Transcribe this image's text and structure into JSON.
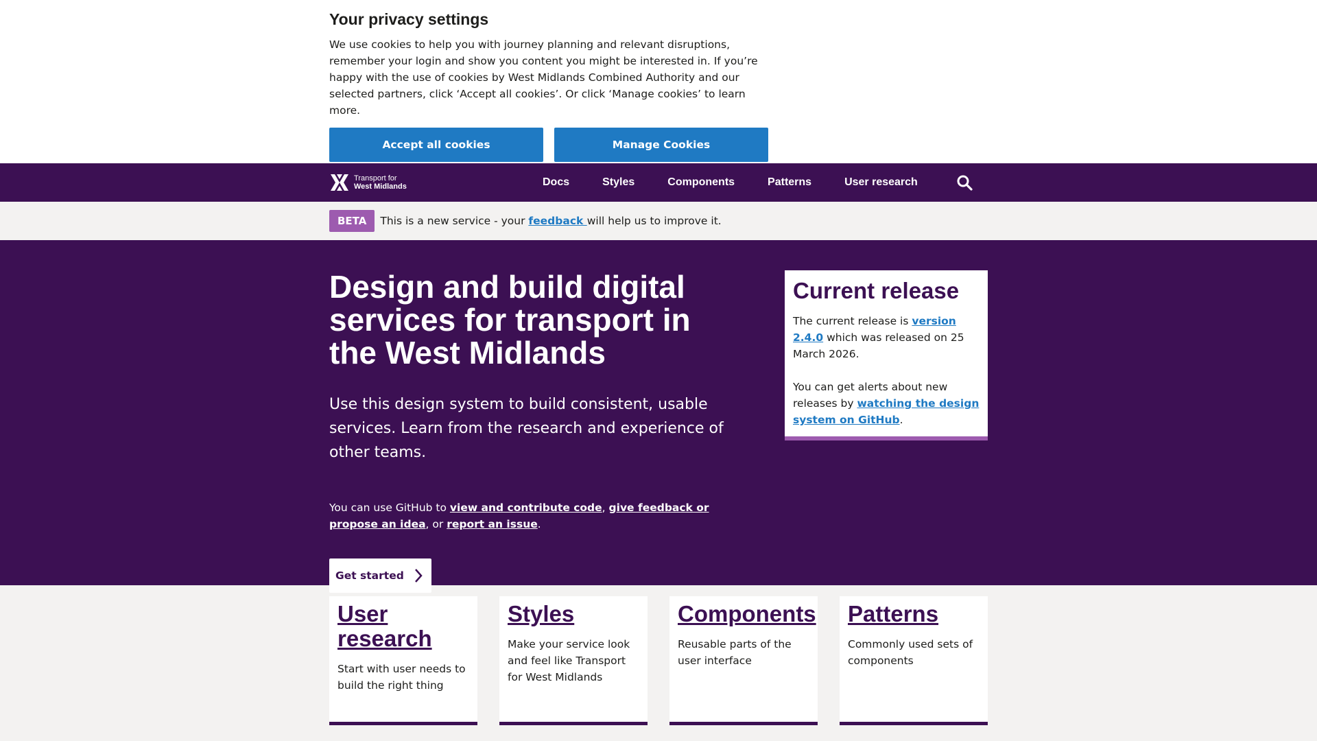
{
  "cookie_banner": {
    "title": "Your privacy settings",
    "text": "We use cookies to help you with journey planning and relevant disruptions, remember your login and show you content you might be interested in. If you’re happy with the use of cookies by West Midlands Combined Authority and our selected partners, click ‘Accept all cookies’. Or click ‘Manage cookies’ to learn more.",
    "accept_label": "Accept all cookies",
    "manage_label": "Manage Cookies"
  },
  "header": {
    "logo_line1": "Transport for",
    "logo_line2": "West Midlands",
    "nav": [
      "Docs",
      "Styles",
      "Components",
      "Patterns",
      "User research"
    ],
    "search_icon": "search-icon"
  },
  "beta_banner": {
    "tag": "BETA",
    "text_before": "This is a new service - your ",
    "link": "feedback ",
    "text_after": "will help us to improve it."
  },
  "hero": {
    "title": "Design and build digital services for transport in the West Midlands",
    "lead": "Use this design system to build consistent, usable services. Learn from the research and experience of other teams.",
    "github_before": "You can use GitHub to ",
    "github_link1": "view and contribute code",
    "github_sep1": ", ",
    "github_link2": "give feedback or propose an idea",
    "github_sep2": ", or ",
    "github_link3": "report an issue",
    "github_end": ".",
    "cta_label": "Get started"
  },
  "release": {
    "title": "Current release",
    "p1_before": "The current release is ",
    "p1_link": "version 2.4.0",
    "p1_after": " which was released on 25 March 2026.",
    "p2_before": "You can get alerts about new releases by ",
    "p2_link": "watching the design system on GitHub",
    "p2_after": "."
  },
  "cards": [
    {
      "title": "User research",
      "text": "Start with user needs to build the right thing"
    },
    {
      "title": "Styles",
      "text": "Make your service look and feel like Transport for West Midlands"
    },
    {
      "title": "Components",
      "text": "Reusable parts of the user interface"
    },
    {
      "title": "Patterns",
      "text": "Commonly used sets of components"
    }
  ],
  "colors": {
    "brand_purple": "#3c1053",
    "beta_purple": "#9d5baf",
    "link_blue": "#1f7ac3",
    "light_grey": "#f3f2f1"
  }
}
